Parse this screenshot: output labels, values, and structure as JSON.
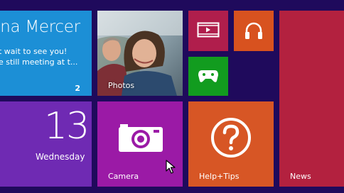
{
  "people": {
    "name": "nna Mercer",
    "message_line1": "t wait to see you!",
    "message_line2": "e still meeting at t...",
    "badge": "2"
  },
  "photos": {
    "label": "Photos"
  },
  "video": {},
  "music": {},
  "games": {},
  "news": {
    "label": "News"
  },
  "calendar": {
    "day": "13",
    "weekday": "Wednesday"
  },
  "camera": {
    "label": "Camera"
  },
  "help": {
    "label": "Help+Tips"
  },
  "colors": {
    "background": "#1f0a5c",
    "people": "#1c8fd6",
    "video": "#b01e4c",
    "music": "#d8521f",
    "games": "#129c1f",
    "news": "#b3213f",
    "calendar": "#6f2ab3",
    "camera": "#9b1aa6",
    "help": "#d75625"
  },
  "icons": {
    "video": "video-icon",
    "music": "headphones-icon",
    "games": "xbox-controller-icon",
    "camera": "camera-icon",
    "help": "question-icon",
    "cursor": "mouse-cursor-icon"
  }
}
